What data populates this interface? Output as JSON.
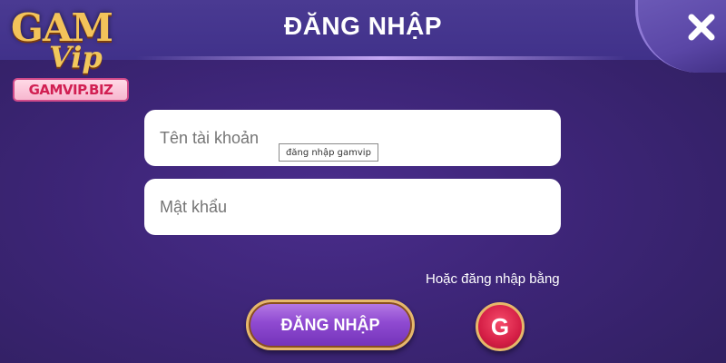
{
  "logo": {
    "word_top": "GAM",
    "word_script": "Vip",
    "site_tag": "GAMVIP.BIZ"
  },
  "header": {
    "title": "ĐĂNG NHẬP",
    "close_icon": "close-icon"
  },
  "form": {
    "username_placeholder": "Tên tài khoản",
    "password_placeholder": "Mật khẩu",
    "tooltip_text": "đăng nhập gamvip"
  },
  "actions": {
    "alt_login_label": "Hoặc đăng nhập bằng",
    "login_button_label": "ĐĂNG NHẬP",
    "google_button_label": "G",
    "google_icon": "google-icon"
  },
  "colors": {
    "background": "#3d2577",
    "header": "#4a3a92",
    "button_purple": "#8f4ad1",
    "gold_border": "#e6b86a",
    "google_red": "#d51f46",
    "text_white": "#ffffff"
  }
}
